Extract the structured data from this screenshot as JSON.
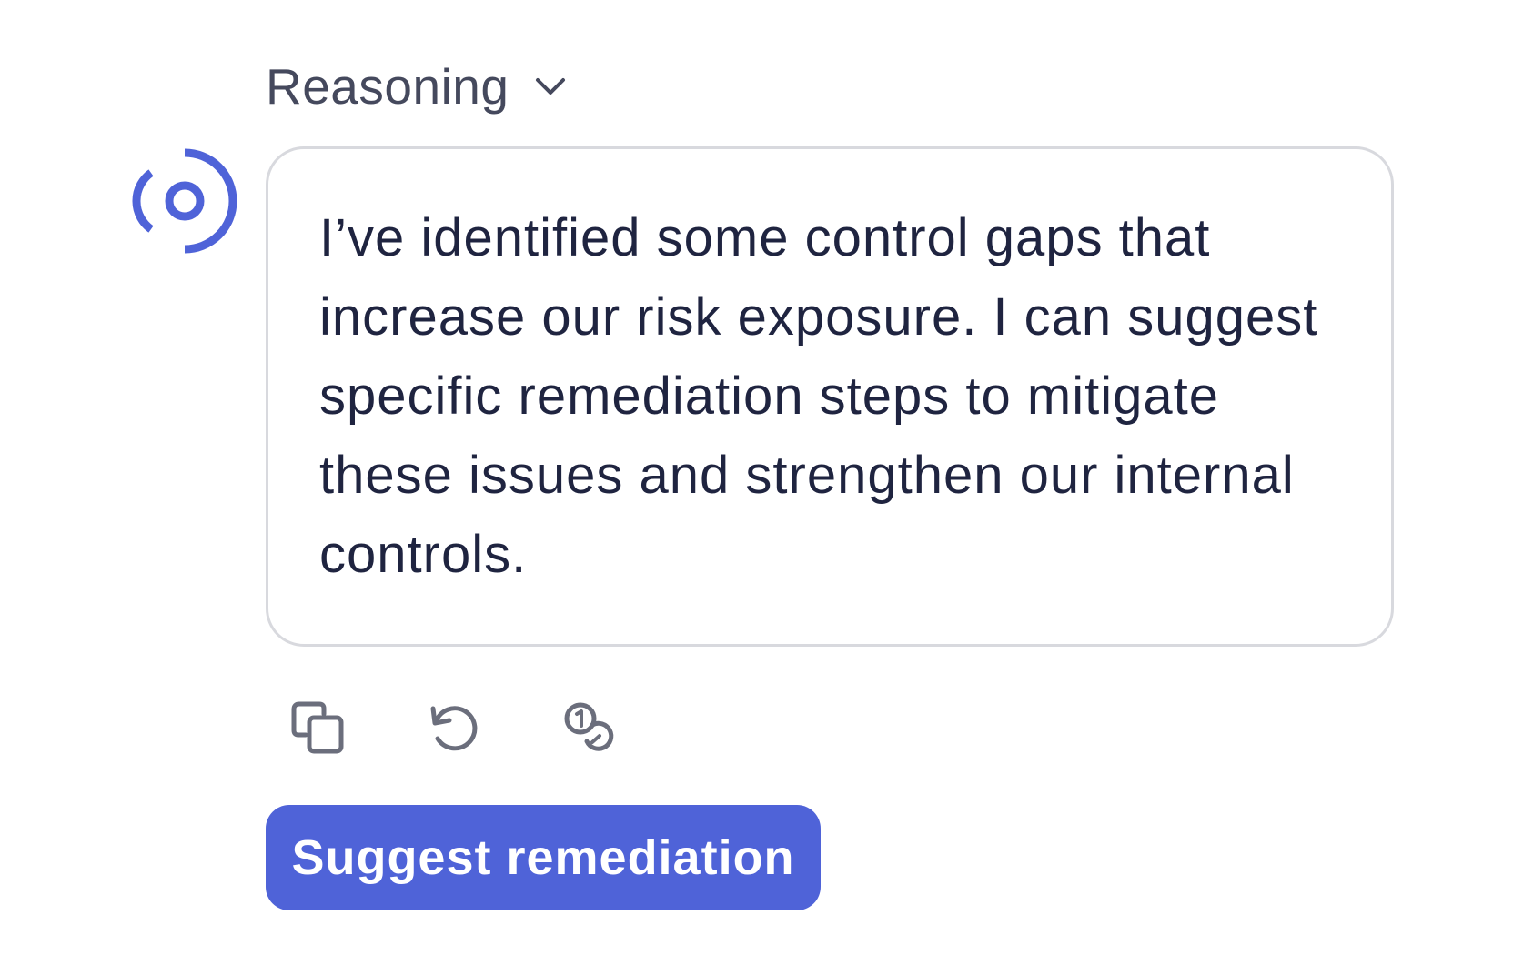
{
  "reasoning": {
    "label": "Reasoning",
    "icon": "chevron-down-icon"
  },
  "assistant": {
    "avatar_icon": "broadcast-icon",
    "accent_color": "#4f63d8",
    "message": "I’ve identified some control gaps that increase our risk exposure. I can suggest specific remediation steps to mitigate these issues and strengthen our internal controls."
  },
  "actions": [
    {
      "icon": "copy-icon"
    },
    {
      "icon": "regenerate-icon"
    },
    {
      "icon": "coins-icon"
    }
  ],
  "primary_action": {
    "label": "Suggest remediation",
    "color": "#4f63d8"
  }
}
